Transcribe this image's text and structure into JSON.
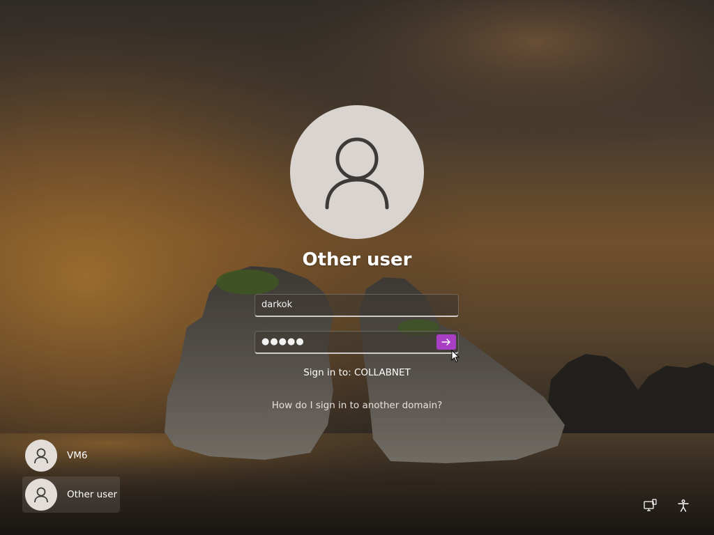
{
  "login": {
    "user_title": "Other user",
    "username_value": "darkok",
    "password_mask": "●●●●●",
    "sign_in_to": "Sign in to: COLLABNET",
    "other_domain_link": "How do I sign in to another domain?",
    "submit_icon": "arrow-right-icon",
    "accent_color": "#a83fc3"
  },
  "user_list": {
    "items": [
      {
        "label": "VM6",
        "icon": "user-icon",
        "selected": false
      },
      {
        "label": "Other user",
        "icon": "user-icon",
        "selected": true
      }
    ]
  },
  "system_icons": {
    "network": "network-icon",
    "accessibility": "accessibility-icon"
  }
}
